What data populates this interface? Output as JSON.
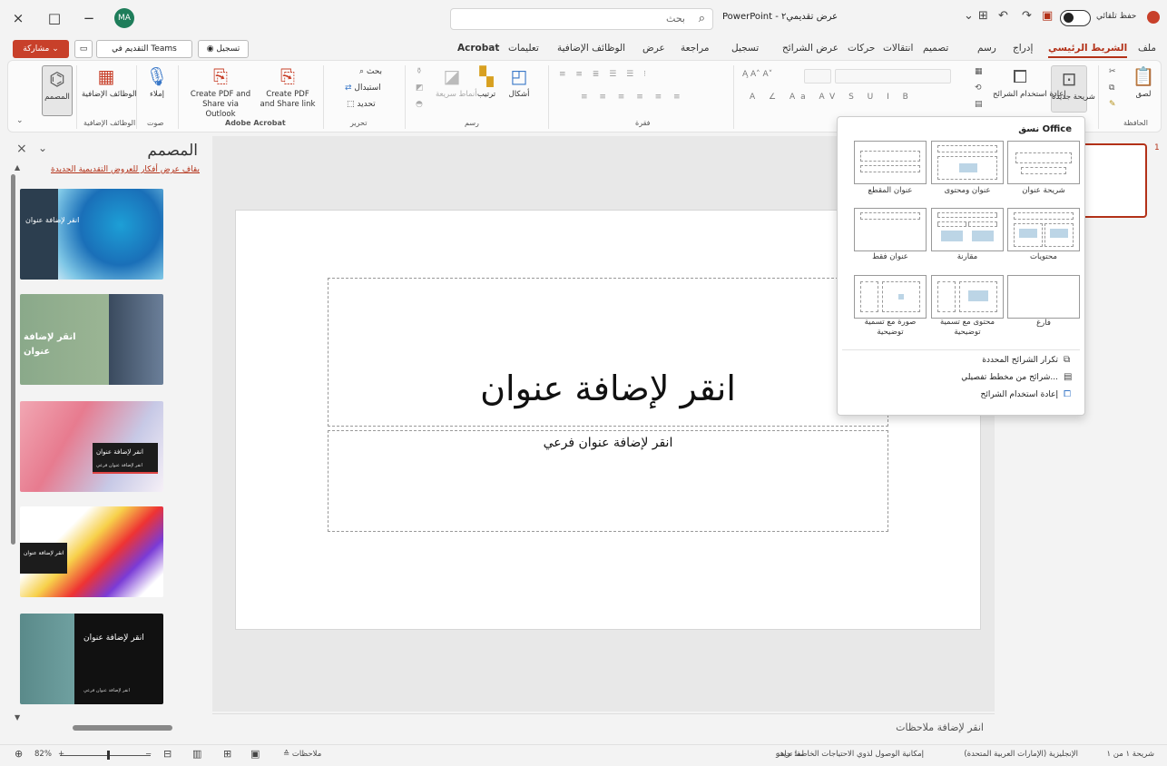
{
  "titlebar": {
    "close": "×",
    "restore": "□",
    "minimize": "−",
    "avatar": "MA",
    "search_placeholder": "بحث",
    "doc_title": "PowerPoint - عرض تقديمي٢",
    "autosave": "حفظ تلقائي"
  },
  "tabs": [
    "ملف",
    "الشريط الرئيسي",
    "إدراج",
    "رسم",
    "تصميم",
    "انتقالات",
    "حركات",
    "عرض الشرائح",
    "تسجيل",
    "مراجعة",
    "عرض",
    "الوظائف الإضافية",
    "تعليمات",
    "Acrobat"
  ],
  "toolbar": {
    "share": "مشاركة",
    "teams": "التقديم في Teams",
    "record": "تسجيل"
  },
  "ribbon": {
    "clipboard": {
      "label": "الحافظة",
      "paste": "لصق"
    },
    "slides": {
      "new_slide": "شريحة جديدة",
      "reuse": "إعادة استخدام الشرائح"
    },
    "paragraph": "فقرة",
    "drawing": {
      "label": "رسم",
      "shapes": "أشكال",
      "arrange": "ترتيب",
      "styles": "أنماط سريعة"
    },
    "editing": {
      "label": "تحرير",
      "find": "بحث",
      "replace": "استبدال",
      "select": "تحديد"
    },
    "acrobat": {
      "label": "Adobe Acrobat",
      "share_link": "Create PDF and Share link",
      "share_outlook": "Create PDF and Share via Outlook"
    },
    "voice": {
      "label": "صوت",
      "dictate": "إملاء"
    },
    "addins": {
      "label": "الوظائف الإضافية",
      "addins": "الوظائف الإضافية"
    },
    "designer": "المصمم"
  },
  "designer": {
    "title": "المصمم",
    "link": "بقاف عرض أفكار للعروض التقديمية الجديدة",
    "thumb1_title": "انقر لإضافة عنوان",
    "thumb2_title": "انقر لإضافة عنوان",
    "thumb3_title": "انقر لإضافة عنوان",
    "thumb3_sub": "انقر لإضافة عنوان فرعي",
    "thumb4_title": "انقر لإضافة عنوان",
    "thumb5_title": "انقر لإضافة عنوان",
    "thumb5_sub": "انقر لإضافة عنوان فرعي"
  },
  "slide": {
    "title": "انقر لإضافة عنوان",
    "subtitle": "انقر لإضافة عنوان فرعي"
  },
  "notes": "انقر لإضافة ملاحظات",
  "thumb_panel": {
    "slide_number": "1"
  },
  "dropdown": {
    "header": "نسق Office",
    "layouts": [
      "شريحة عنوان",
      "عنوان ومحتوى",
      "عنوان المقطع",
      "محتويات",
      "مقارنة",
      "عنوان فقط",
      "فارغ",
      "محتوى مع تسمية توضيحية",
      "صورة مع تسمية توضيحية"
    ],
    "menu": [
      "تكرار الشرائح المحددة",
      "شرائح من مخطط تفصيلي...",
      "إعادة استخدام الشرائح"
    ]
  },
  "status": {
    "slide_count": "شريحة ١ من ١",
    "language": "الإنجليزية (الإمارات العربية المتحدة)",
    "accessibility": "إمكانية الوصول لذوي الاحتياجات الخاصة: جاهز",
    "feedback": "لما تريده",
    "notes_btn": "ملاحظات",
    "zoom": "82%"
  }
}
